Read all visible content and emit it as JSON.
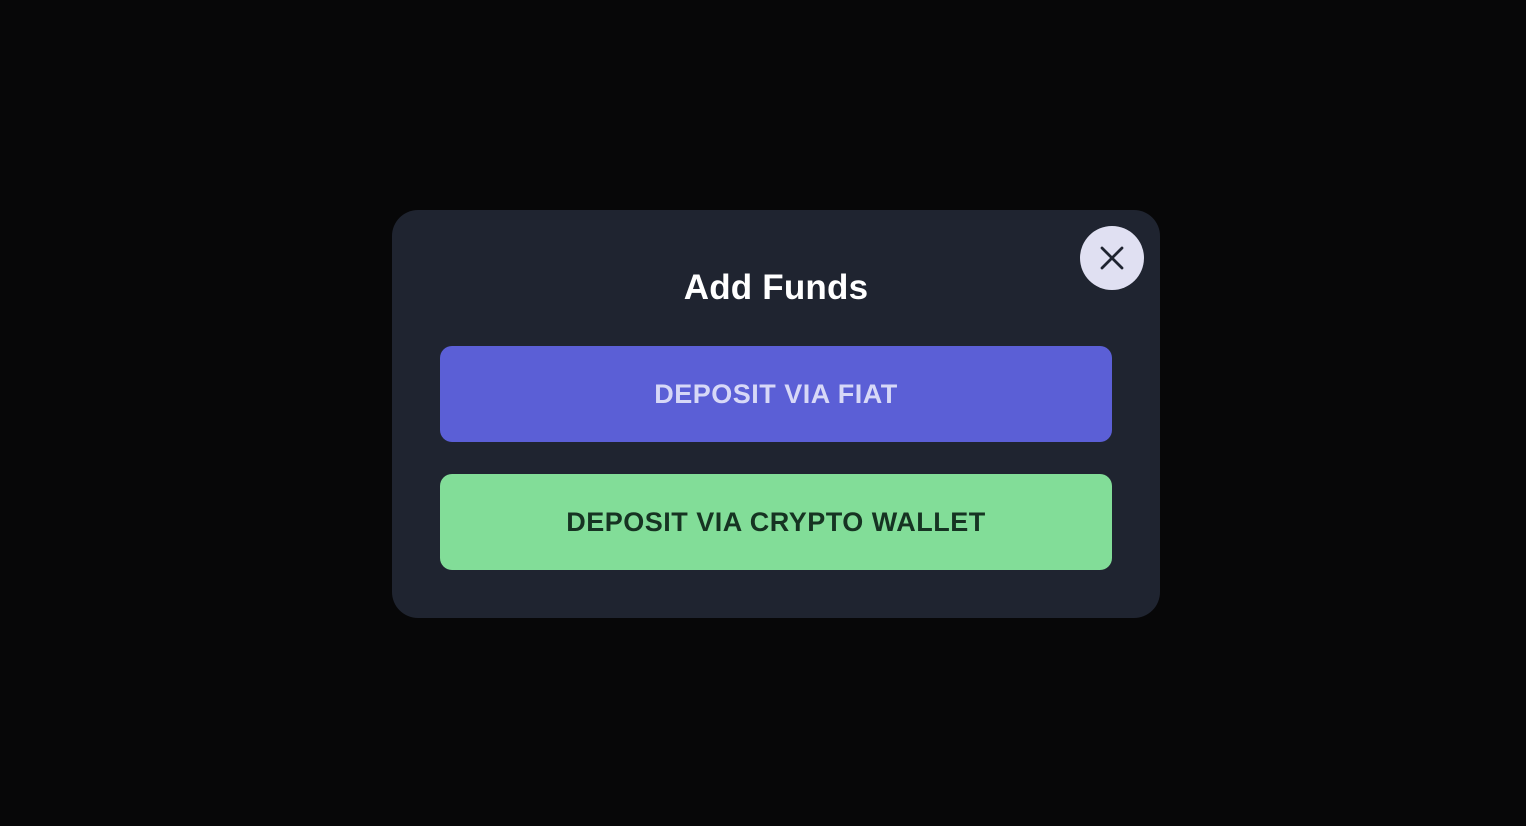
{
  "modal": {
    "title": "Add Funds",
    "close_icon": "close-icon",
    "buttons": {
      "fiat_label": "DEPOSIT VIA FIAT",
      "crypto_label": "DEPOSIT VIA CRYPTO WALLET"
    }
  },
  "colors": {
    "page_background": "#070708",
    "modal_background": "#1f2430",
    "title_text": "#ffffff",
    "close_button_background": "#e0e0f2",
    "close_icon_color": "#1f2430",
    "fiat_button_background": "#5b5fd6",
    "fiat_button_text": "#d7d8f7",
    "crypto_button_background": "#82dd98",
    "crypto_button_text": "#163322"
  }
}
